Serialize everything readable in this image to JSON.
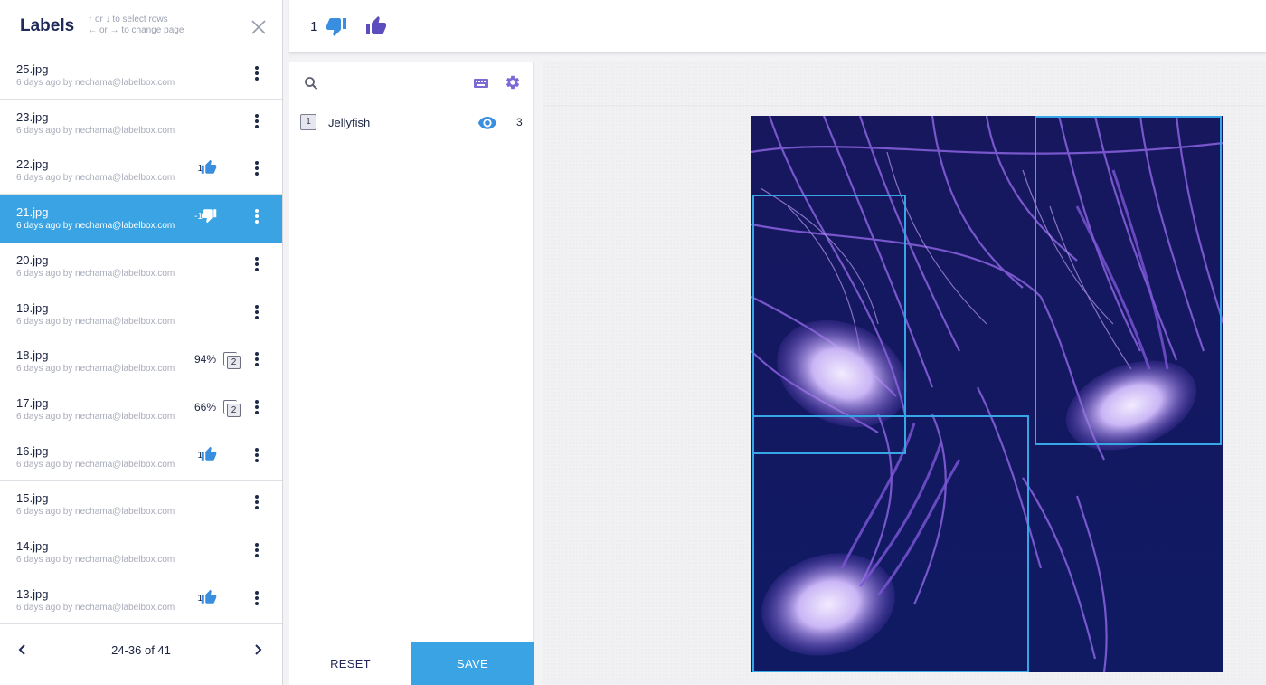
{
  "labels_panel": {
    "title": "Labels",
    "hint_line1": "↑ or ↓ to select rows",
    "hint_line2": "← or → to change page",
    "rows": [
      {
        "name": "25.jpg",
        "sub": "6 days ago by nechama@labelbox.com"
      },
      {
        "name": "23.jpg",
        "sub": "6 days ago by nechama@labelbox.com"
      },
      {
        "name": "22.jpg",
        "sub": "6 days ago by nechama@labelbox.com",
        "score": "1",
        "vote": "up"
      },
      {
        "name": "21.jpg",
        "sub": "6 days ago by nechama@labelbox.com",
        "score": "-1",
        "vote": "down",
        "selected": true
      },
      {
        "name": "20.jpg",
        "sub": "6 days ago by nechama@labelbox.com"
      },
      {
        "name": "19.jpg",
        "sub": "6 days ago by nechama@labelbox.com"
      },
      {
        "name": "18.jpg",
        "sub": "6 days ago by nechama@labelbox.com",
        "agreement": "94%",
        "copies": "2"
      },
      {
        "name": "17.jpg",
        "sub": "6 days ago by nechama@labelbox.com",
        "agreement": "66%",
        "copies": "2"
      },
      {
        "name": "16.jpg",
        "sub": "6 days ago by nechama@labelbox.com",
        "score": "1",
        "vote": "up"
      },
      {
        "name": "15.jpg",
        "sub": "6 days ago by nechama@labelbox.com"
      },
      {
        "name": "14.jpg",
        "sub": "6 days ago by nechama@labelbox.com"
      },
      {
        "name": "13.jpg",
        "sub": "6 days ago by nechama@labelbox.com",
        "score": "1",
        "vote": "up"
      }
    ],
    "pager": "24-36 of 41"
  },
  "topbar": {
    "count": "1"
  },
  "tools": {
    "items": [
      {
        "hotkey": "1",
        "name": "Jellyfish",
        "count": "3"
      }
    ],
    "reset_label": "RESET",
    "save_label": "SAVE"
  },
  "colors": {
    "accent": "#3aa3e3",
    "thumb_blue": "#3a8ee0",
    "thumb_purple": "#5b4dbe",
    "tool_purple": "#6a5acd",
    "bbox": "#36a6e6"
  }
}
